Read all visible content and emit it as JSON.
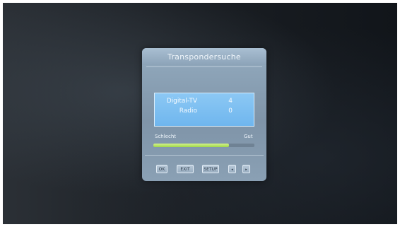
{
  "dialog": {
    "title": "Transpondersuche",
    "results": [
      {
        "label": "Digital-TV",
        "value": "4"
      },
      {
        "label": "Radio",
        "value": "0"
      }
    ],
    "signal": {
      "left_label": "Schlecht",
      "right_label": "Gut",
      "level_percent": 75
    },
    "buttons": {
      "ok": "OK",
      "exit": "EXIT",
      "setup": "SETUP",
      "left_arrow": "◂",
      "right_arrow": "▸"
    }
  },
  "colors": {
    "panel": "#8ea5b9",
    "results_bg": "#7dbff2",
    "signal_fill": "#a8dc55"
  }
}
